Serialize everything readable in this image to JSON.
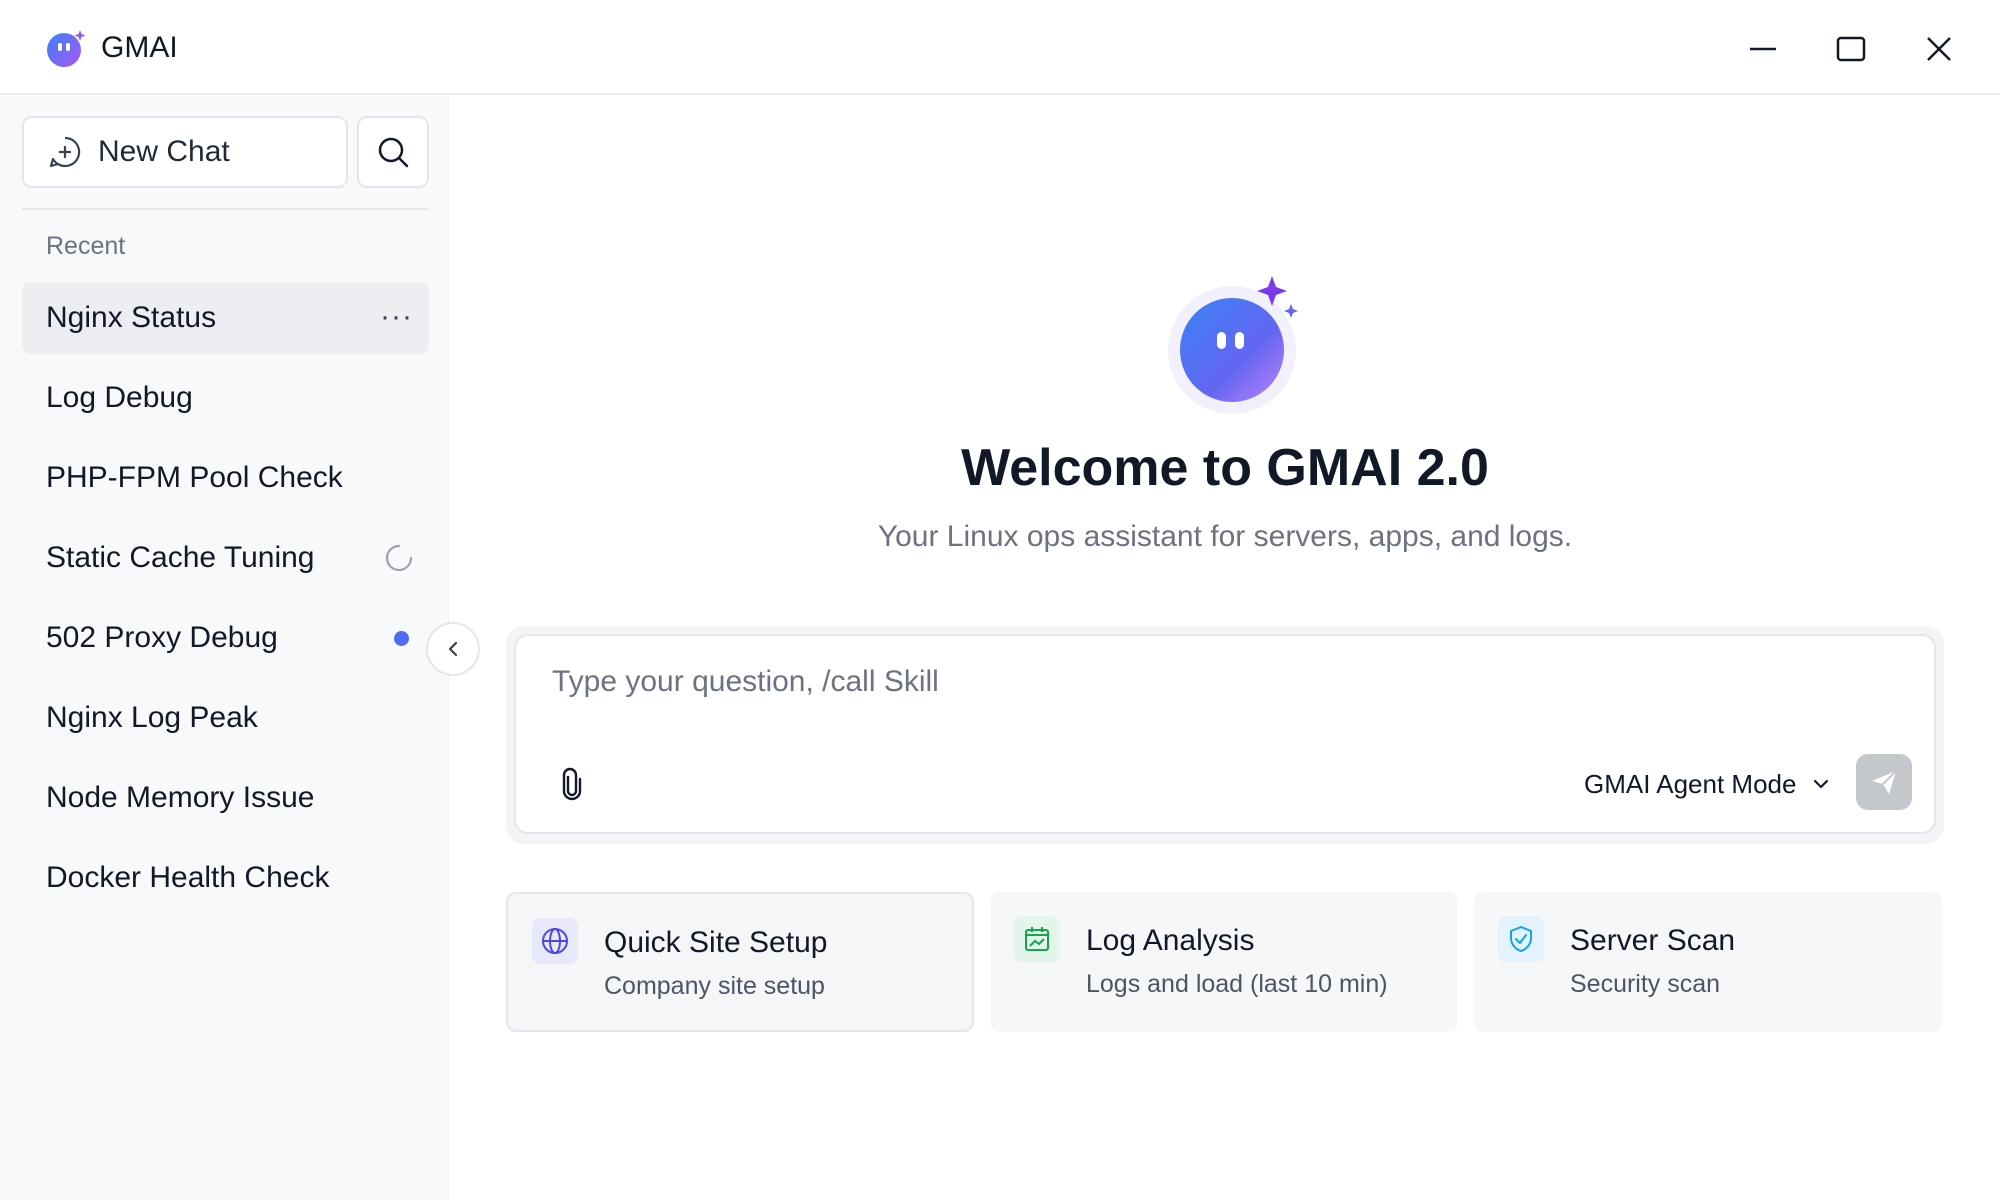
{
  "window": {
    "title": "GMAI"
  },
  "sidebar": {
    "new_chat_label": "New Chat",
    "recent_label": "Recent",
    "items": [
      {
        "label": "Nginx Status",
        "state": "active"
      },
      {
        "label": "Log Debug"
      },
      {
        "label": "PHP-FPM Pool Check"
      },
      {
        "label": "Static Cache Tuning",
        "state": "loading"
      },
      {
        "label": "502 Proxy Debug",
        "state": "unread"
      },
      {
        "label": "Nginx Log Peak"
      },
      {
        "label": "Node Memory Issue"
      },
      {
        "label": "Docker Health Check"
      }
    ],
    "more_label": "···"
  },
  "main": {
    "welcome": "Welcome to GMAI 2.0",
    "subtitle": "Your Linux ops assistant for servers, apps, and logs.",
    "input": {
      "placeholder": "Type your question, /call Skill",
      "value": "",
      "mode_label": "GMAI Agent Mode"
    },
    "cards": [
      {
        "title": "Quick Site Setup",
        "subtitle": "Company site setup",
        "icon": "globe-icon",
        "accent": "#4f46e5"
      },
      {
        "title": "Log Analysis",
        "subtitle": "Logs and load (last 10 min)",
        "icon": "calendar-chart-icon",
        "accent": "#16a34a"
      },
      {
        "title": "Server Scan",
        "subtitle": "Security scan",
        "icon": "shield-check-icon",
        "accent": "#0ea5e9"
      }
    ]
  },
  "colors": {
    "accent": "#4f6cf7",
    "sidebar_bg": "#f8f9fb",
    "send_disabled": "#c4c7cc"
  }
}
